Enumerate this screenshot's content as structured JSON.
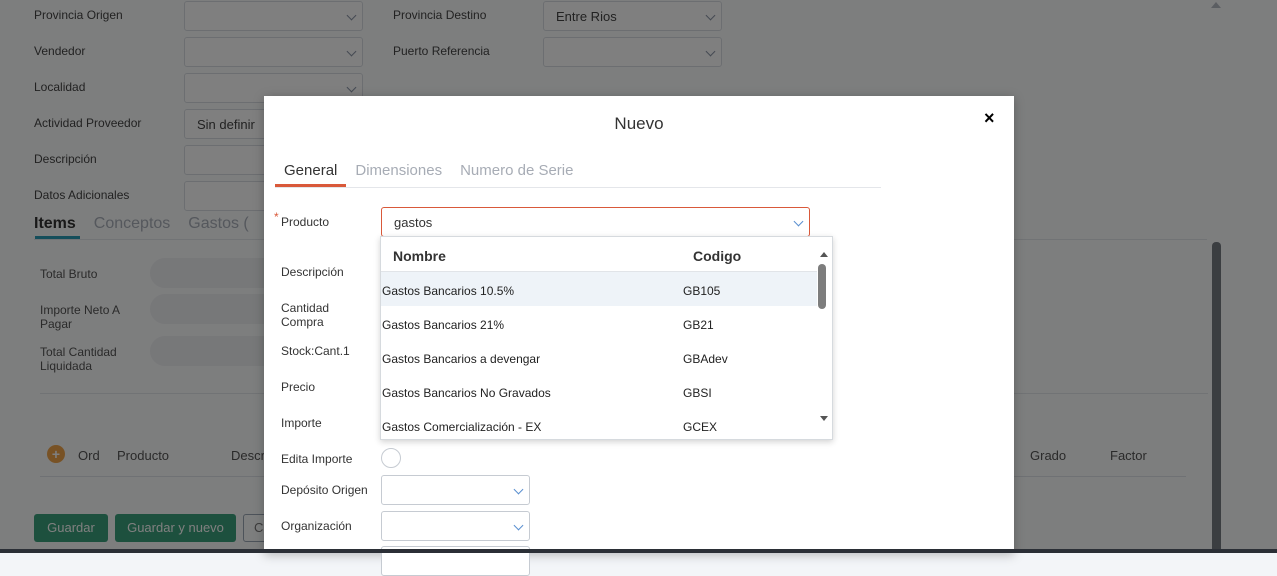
{
  "form": {
    "provincia_origen_label": "Provincia Origen",
    "provincia_destino_label": "Provincia Destino",
    "provincia_destino_value": "Entre Rios",
    "vendedor_label": "Vendedor",
    "puerto_referencia_label": "Puerto Referencia",
    "localidad_label": "Localidad",
    "actividad_proveedor_label": "Actividad Proveedor",
    "actividad_proveedor_value": "Sin definir",
    "descripcion_label": "Descripción",
    "datos_adicionales_label": "Datos Adicionales"
  },
  "tabs": {
    "items": "Items",
    "conceptos": "Conceptos",
    "gastos": "Gastos ("
  },
  "totals": {
    "total_bruto": "Total Bruto",
    "importe_neto": "Importe Neto A Pagar",
    "total_cantidad": "Total Cantidad Liquidada"
  },
  "grid_columns": {
    "ord": "Ord",
    "producto": "Producto",
    "descr": "Descr",
    "grado": "Grado",
    "factor": "Factor"
  },
  "actions": {
    "guardar": "Guardar",
    "guardar_nuevo": "Guardar y nuevo",
    "other": "C"
  },
  "modal": {
    "title": "Nuevo",
    "close": "×",
    "tabs": [
      "General",
      "Dimensiones",
      "Numero de Serie"
    ],
    "required_mark": "*",
    "fields": {
      "producto": "Producto",
      "descripcion": "Descripción",
      "cantidad_compra": "Cantidad Compra",
      "stock": "Stock:Cant.1",
      "precio": "Precio",
      "importe": "Importe",
      "edita_importe": "Edita Importe",
      "deposito_origen": "Depósito Origen",
      "organizacion": "Organización"
    },
    "producto_value": "gastos"
  },
  "dropdown": {
    "col_nombre": "Nombre",
    "col_codigo": "Codigo",
    "rows": [
      {
        "nombre": "Gastos Bancarios 10.5%",
        "codigo": "GB105"
      },
      {
        "nombre": "Gastos Bancarios 21%",
        "codigo": "GB21"
      },
      {
        "nombre": "Gastos Bancarios a devengar",
        "codigo": "GBAdev"
      },
      {
        "nombre": "Gastos Bancarios No Gravados",
        "codigo": "GBSI"
      },
      {
        "nombre": "Gastos Comercialización - EX",
        "codigo": "GCEX"
      }
    ]
  }
}
